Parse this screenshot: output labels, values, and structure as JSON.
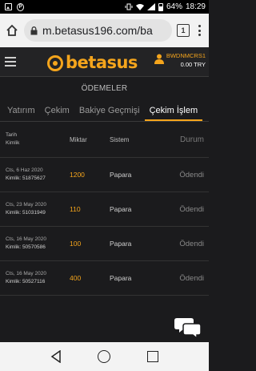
{
  "status_bar": {
    "battery": "64%",
    "time": "18:29"
  },
  "browser": {
    "url": "m.betasus196.com/ba",
    "tab_count": "1"
  },
  "site": {
    "brand": "betasus",
    "brand_color": "#f5a51c",
    "username": "BWDNMCRS1",
    "balance": "0.00 TRY"
  },
  "page": {
    "title": "ÖDEMELER"
  },
  "tabs": [
    {
      "label": "Yatırım",
      "active": false
    },
    {
      "label": "Çekim",
      "active": false
    },
    {
      "label": "Bakiye Geçmişi",
      "active": false
    },
    {
      "label": "Çekim İşlem",
      "active": true
    }
  ],
  "table": {
    "headers": {
      "date": "Tarih",
      "id": "Kimlik",
      "amount": "Miktar",
      "system": "Sistem",
      "status": "Durum"
    },
    "rows": [
      {
        "date": "Cts, 6 Haz 2020",
        "id": "Kimlik: 51875627",
        "amount": "1200",
        "system": "Papara",
        "status": "Ödendi"
      },
      {
        "date": "Cts, 23 May 2020",
        "id": "Kimlik: 51031949",
        "amount": "110",
        "system": "Papara",
        "status": "Ödendi"
      },
      {
        "date": "Cts, 16 May 2020",
        "id": "Kimlik: 50570586",
        "amount": "100",
        "system": "Papara",
        "status": "Ödendi"
      },
      {
        "date": "Cts, 16 May 2020",
        "id": "Kimlik: 50527116",
        "amount": "400",
        "system": "Papara",
        "status": "Ödendi"
      }
    ]
  },
  "icons": {
    "chat": "chat-bubbles-icon",
    "home": "home-icon",
    "lock": "lock-icon"
  }
}
